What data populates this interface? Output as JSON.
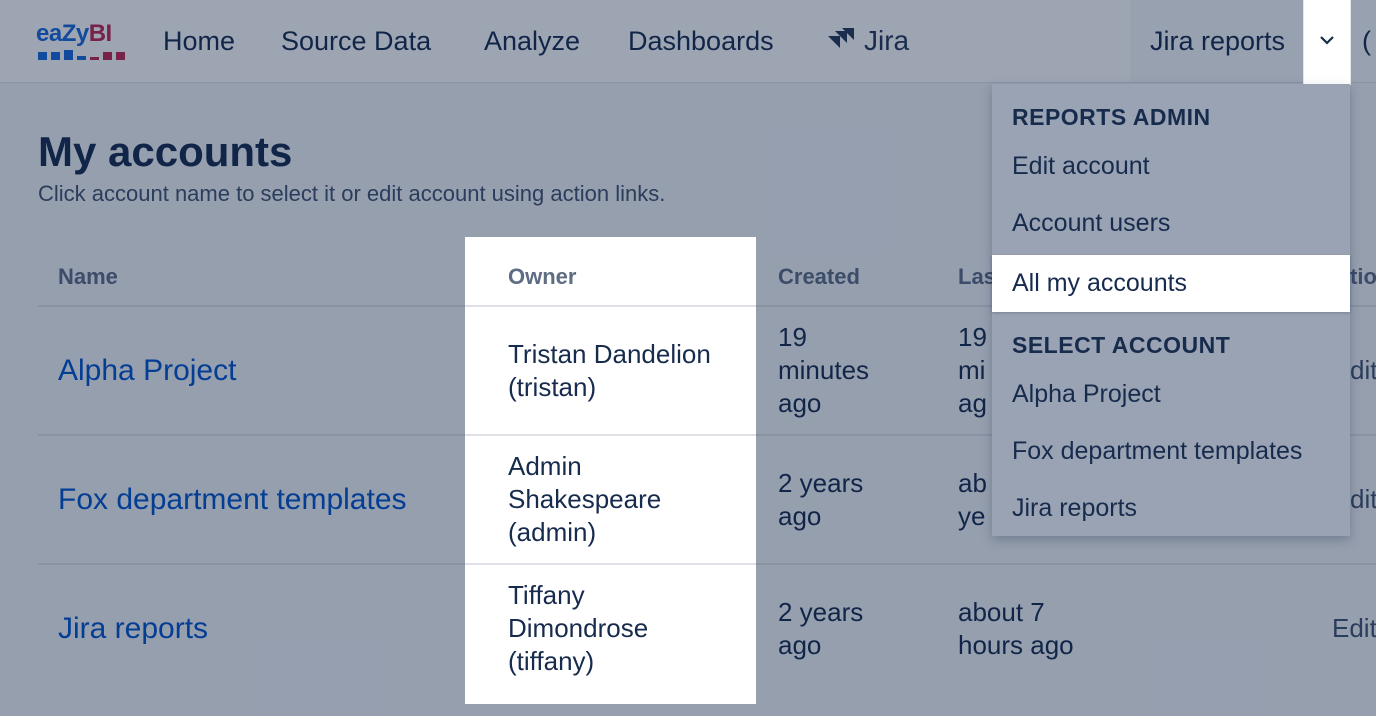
{
  "nav": {
    "logo_text_a": "eaZy",
    "logo_text_b": "BI",
    "items": [
      "Home",
      "Source Data",
      "Analyze",
      "Dashboards"
    ],
    "jira_label": "Jira",
    "current_account": "Jira reports",
    "edge_glyph": "("
  },
  "page": {
    "title": "My accounts",
    "subtitle": "Click account name to select it or edit account using action links."
  },
  "table": {
    "headers": {
      "name": "Name",
      "owner": "Owner",
      "created": "Created",
      "last": "Las",
      "actions": "tio"
    },
    "rows": [
      {
        "name": "Alpha Project",
        "owner": [
          "Tristan Dandelion",
          "(tristan)"
        ],
        "created": [
          "19",
          "minutes",
          "ago"
        ],
        "last": [
          "19",
          "mi",
          "ag"
        ],
        "action": "dit"
      },
      {
        "name": "Fox department templates",
        "owner": [
          "Admin",
          "Shakespeare",
          "(admin)"
        ],
        "created": [
          "2 years",
          "ago"
        ],
        "last": [
          "ab",
          "ye"
        ],
        "action": "dit"
      },
      {
        "name": "Jira reports",
        "owner": [
          "Tiffany",
          "Dimondrose",
          "(tiffany)"
        ],
        "created": [
          "2 years",
          "ago"
        ],
        "last": [
          "about 7",
          "hours ago"
        ],
        "action": "Edit"
      }
    ]
  },
  "dropdown": {
    "admin_header": "REPORTS ADMIN",
    "admin_items": [
      "Edit account",
      "Account users",
      "All my accounts"
    ],
    "select_header": "SELECT ACCOUNT",
    "account_items": [
      "Alpha Project",
      "Fox department templates",
      "Jira reports"
    ]
  },
  "colors": {
    "link": "#0052cc",
    "brand_blue": "#1868db",
    "brand_red": "#c1254f",
    "text": "#172b4d"
  }
}
